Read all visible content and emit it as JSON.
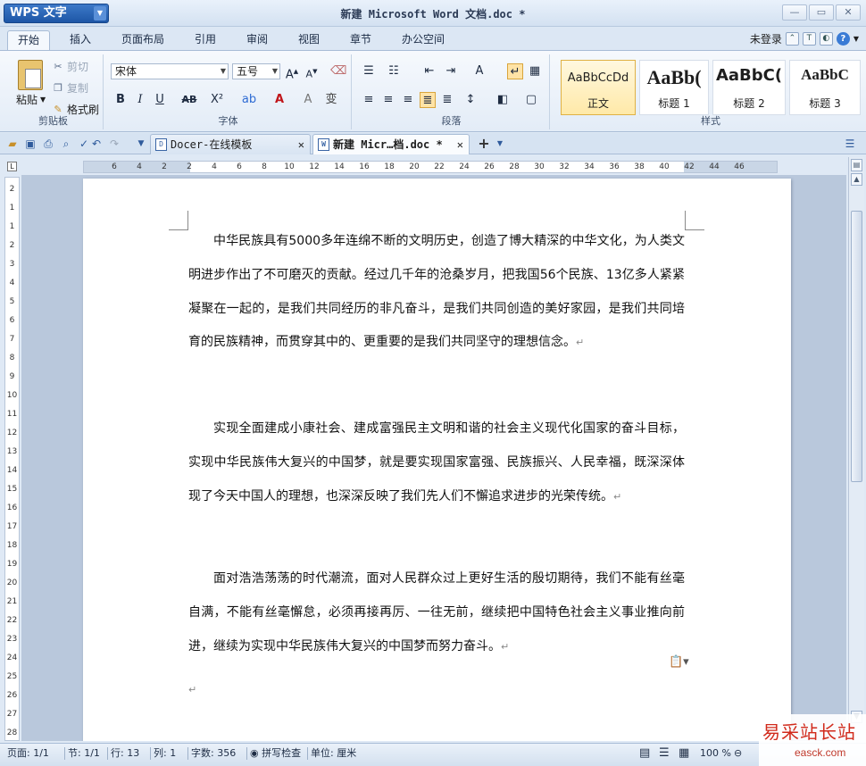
{
  "app": {
    "logo": "WPS 文字",
    "window_title": "新建 Microsoft Word 文档.doc *"
  },
  "menu": {
    "tabs": [
      "开始",
      "插入",
      "页面布局",
      "引用",
      "审阅",
      "视图",
      "章节",
      "办公空间"
    ],
    "login": "未登录"
  },
  "ribbon": {
    "clipboard": {
      "paste": "粘贴",
      "cut": "剪切",
      "copy": "复制",
      "format_painter": "格式刷",
      "label": "剪贴板"
    },
    "font": {
      "name": "宋体",
      "size": "五号",
      "label": "字体"
    },
    "paragraph": {
      "label": "段落"
    },
    "styles": {
      "label": "样式",
      "items": [
        {
          "sample": "AaBbCcDd",
          "name": "正文"
        },
        {
          "sample": "AaBb(",
          "name": "标题 1"
        },
        {
          "sample": "AaBbC(",
          "name": "标题 2"
        },
        {
          "sample": "AaBbC",
          "name": "标题 3"
        }
      ]
    }
  },
  "doc_tabs": [
    {
      "label": "Docer-在线模板"
    },
    {
      "label": "新建 Micr…档.doc *"
    }
  ],
  "ruler": {
    "h_ticks": [
      "6",
      "4",
      "2",
      "2",
      "4",
      "6",
      "8",
      "10",
      "12",
      "14",
      "16",
      "18",
      "20",
      "22",
      "24",
      "26",
      "28",
      "30",
      "32",
      "34",
      "36",
      "38",
      "40",
      "42",
      "44",
      "46"
    ],
    "v_ticks": [
      "2",
      "1",
      "1",
      "2",
      "3",
      "4",
      "5",
      "6",
      "7",
      "8",
      "9",
      "10",
      "11",
      "12",
      "13",
      "14",
      "15",
      "16",
      "17",
      "18",
      "19",
      "20",
      "21",
      "22",
      "23",
      "24",
      "25",
      "26",
      "27",
      "28"
    ]
  },
  "document": {
    "paragraphs": [
      "中华民族具有5000多年连绵不断的文明历史，创造了博大精深的中华文化，为人类文明进步作出了不可磨灭的贡献。经过几千年的沧桑岁月，把我国56个民族、13亿多人紧紧凝聚在一起的，是我们共同经历的非凡奋斗，是我们共同创造的美好家园，是我们共同培育的民族精神，而贯穿其中的、更重要的是我们共同坚守的理想信念。",
      "实现全面建成小康社会、建成富强民主文明和谐的社会主义现代化国家的奋斗目标，实现中华民族伟大复兴的中国梦，就是要实现国家富强、民族振兴、人民幸福，既深深体现了今天中国人的理想，也深深反映了我们先人们不懈追求进步的光荣传统。",
      "面对浩浩荡荡的时代潮流，面对人民群众过上更好生活的殷切期待，我们不能有丝毫自满，不能有丝毫懈怠，必须再接再厉、一往无前，继续把中国特色社会主义事业推向前进，继续为实现中华民族伟大复兴的中国梦而努力奋斗。"
    ],
    "para_mark": "↵"
  },
  "status": {
    "page": "页面: 1/1",
    "section": "节: 1/1",
    "line": "行: 13",
    "col": "列: 1",
    "words": "字数: 356",
    "spell": "拼写检查",
    "unit": "单位: 厘米",
    "zoom": "100 %"
  },
  "watermark": {
    "text": "易采站长站",
    "url": "easck.com"
  },
  "colors": {
    "accent": "#1d56a6",
    "ribbon_bg": "#e3ecf7",
    "selected_style": "#ffe9a8",
    "watermark": "#d12a1b"
  }
}
